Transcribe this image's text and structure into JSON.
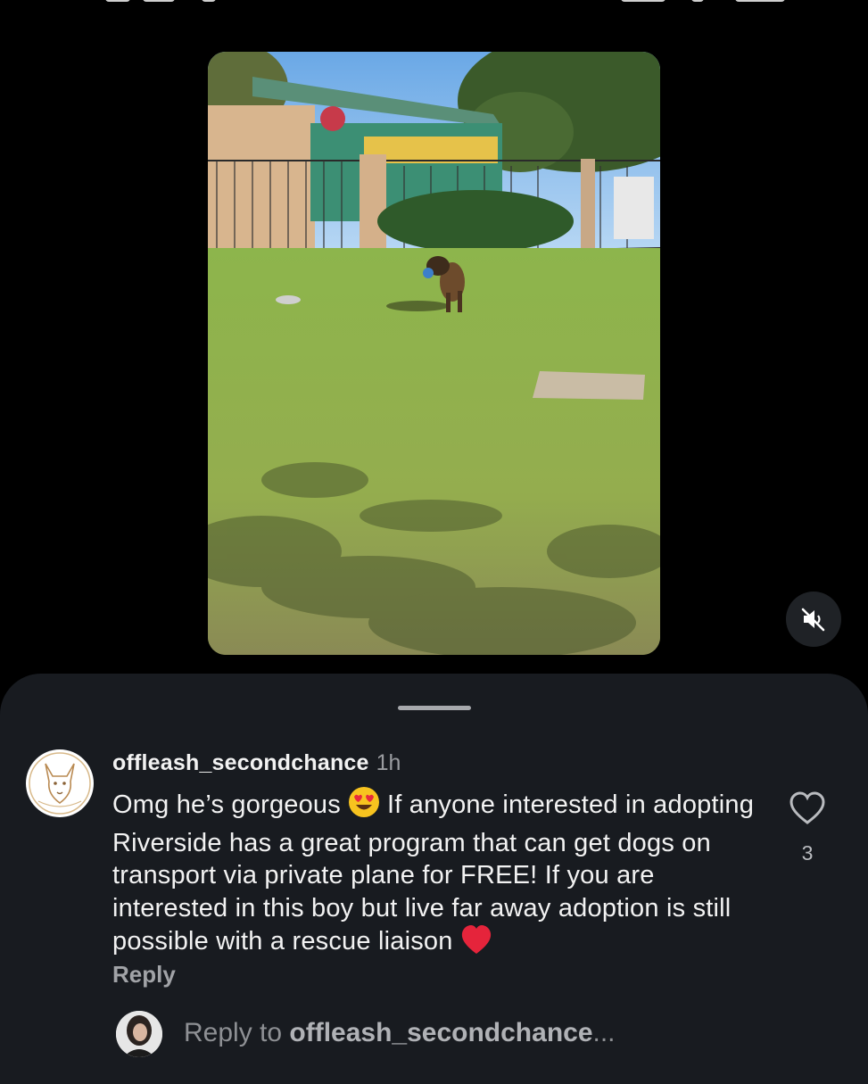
{
  "comment": {
    "username": "offleash_secondchance",
    "time": "1h",
    "text_part1": "Omg he’s gorgeous",
    "emoji1": "heart-eyes-emoji",
    "text_part2": "If anyone interested in adopting Riverside has a great program that can get dogs on transport via private plane for FREE! If you are interested in this boy but live far away adoption is still possible with a rescue liaison",
    "emoji2": "red-heart-emoji",
    "reply_label": "Reply",
    "like_count": "3"
  },
  "reply_bar": {
    "prefix": "Reply to ",
    "username": "offleash_secondchance",
    "ellipsis": "..."
  },
  "colors": {
    "background": "#000000",
    "sheet": "#181b20",
    "text": "#f2f2f2",
    "muted": "#9a9ca0"
  },
  "icons": [
    "speaker-muted-icon",
    "heart-outline-icon",
    "drag-handle"
  ]
}
